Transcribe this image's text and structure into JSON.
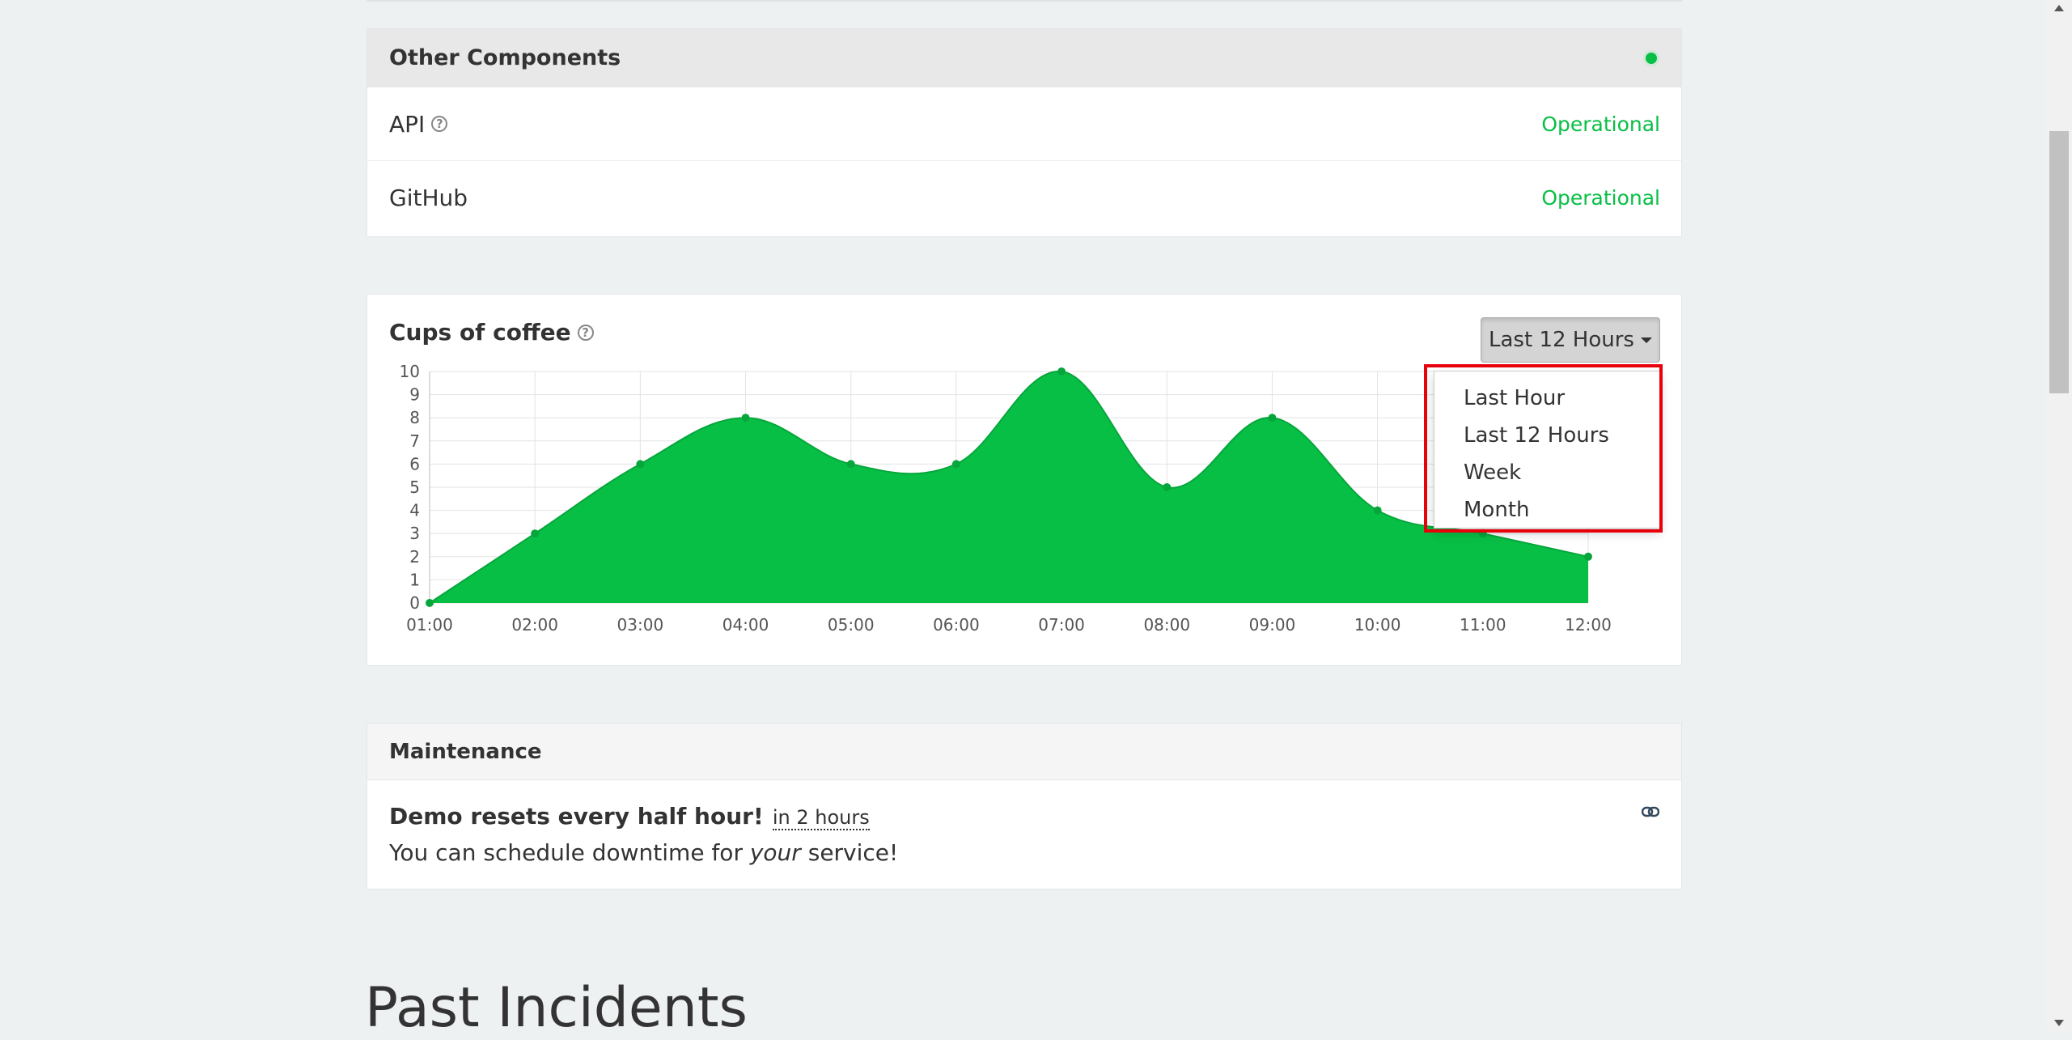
{
  "components_group": {
    "title": "Other Components",
    "items": [
      {
        "name": "API",
        "status": "Operational",
        "has_help": true
      },
      {
        "name": "GitHub",
        "status": "Operational",
        "has_help": false
      }
    ]
  },
  "metric": {
    "title": "Cups of coffee",
    "range_label": "Last 12 Hours",
    "dropdown_options": [
      "Last Hour",
      "Last 12 Hours",
      "Week",
      "Month"
    ]
  },
  "chart_data": {
    "type": "area",
    "title": "",
    "xlabel": "",
    "ylabel": "",
    "x": [
      "01:00",
      "02:00",
      "03:00",
      "04:00",
      "05:00",
      "06:00",
      "07:00",
      "08:00",
      "09:00",
      "10:00",
      "11:00",
      "12:00"
    ],
    "series": [
      {
        "values": [
          0,
          3,
          6,
          8,
          6,
          6,
          10,
          5,
          8,
          4,
          3,
          2
        ]
      }
    ],
    "ylim": [
      0,
      10
    ],
    "yticks": [
      0,
      1,
      2,
      3,
      4,
      5,
      6,
      7,
      8,
      9,
      10
    ],
    "grid": true,
    "color": "#08bf45"
  },
  "maintenance": {
    "header": "Maintenance",
    "name": "Demo resets every half hour!",
    "when": "in 2 hours",
    "message_before": "You can schedule downtime for ",
    "message_em": "your",
    "message_after": " service!"
  },
  "past_incidents": {
    "title": "Past Incidents"
  },
  "colors": {
    "operational": "#08bf45",
    "highlight": "#e8000b"
  }
}
